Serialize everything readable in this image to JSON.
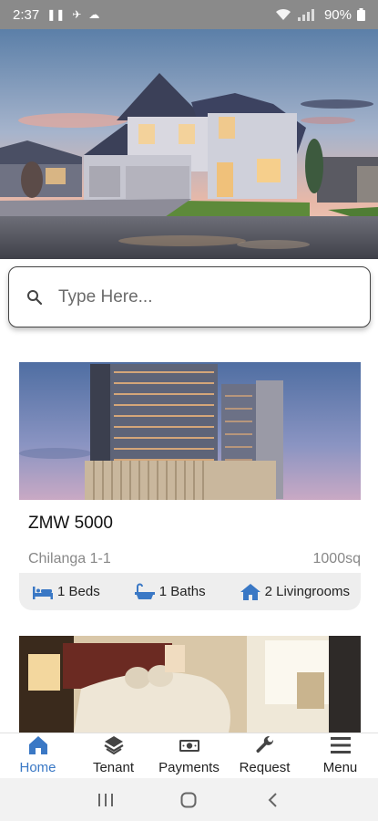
{
  "status_bar": {
    "time": "2:37",
    "battery": "90%"
  },
  "search": {
    "placeholder": "Type Here..."
  },
  "listing": {
    "price": "ZMW 5000",
    "location": "Chilanga 1-1",
    "size": "1000sq",
    "beds": "1 Beds",
    "baths": "1 Baths",
    "livingrooms": "2 Livingrooms"
  },
  "bottom_nav": {
    "items": [
      {
        "label": "Home",
        "icon": "home-icon",
        "active": true
      },
      {
        "label": "Tenant",
        "icon": "tenant-icon",
        "active": false
      },
      {
        "label": "Payments",
        "icon": "money-icon",
        "active": false
      },
      {
        "label": "Request",
        "icon": "wrench-icon",
        "active": false
      },
      {
        "label": "Menu",
        "icon": "menu-icon",
        "active": false
      }
    ]
  },
  "colors": {
    "accent": "#3a78c5",
    "status_bar": "#8a8a8a",
    "feature_bar": "#eeeeee"
  }
}
